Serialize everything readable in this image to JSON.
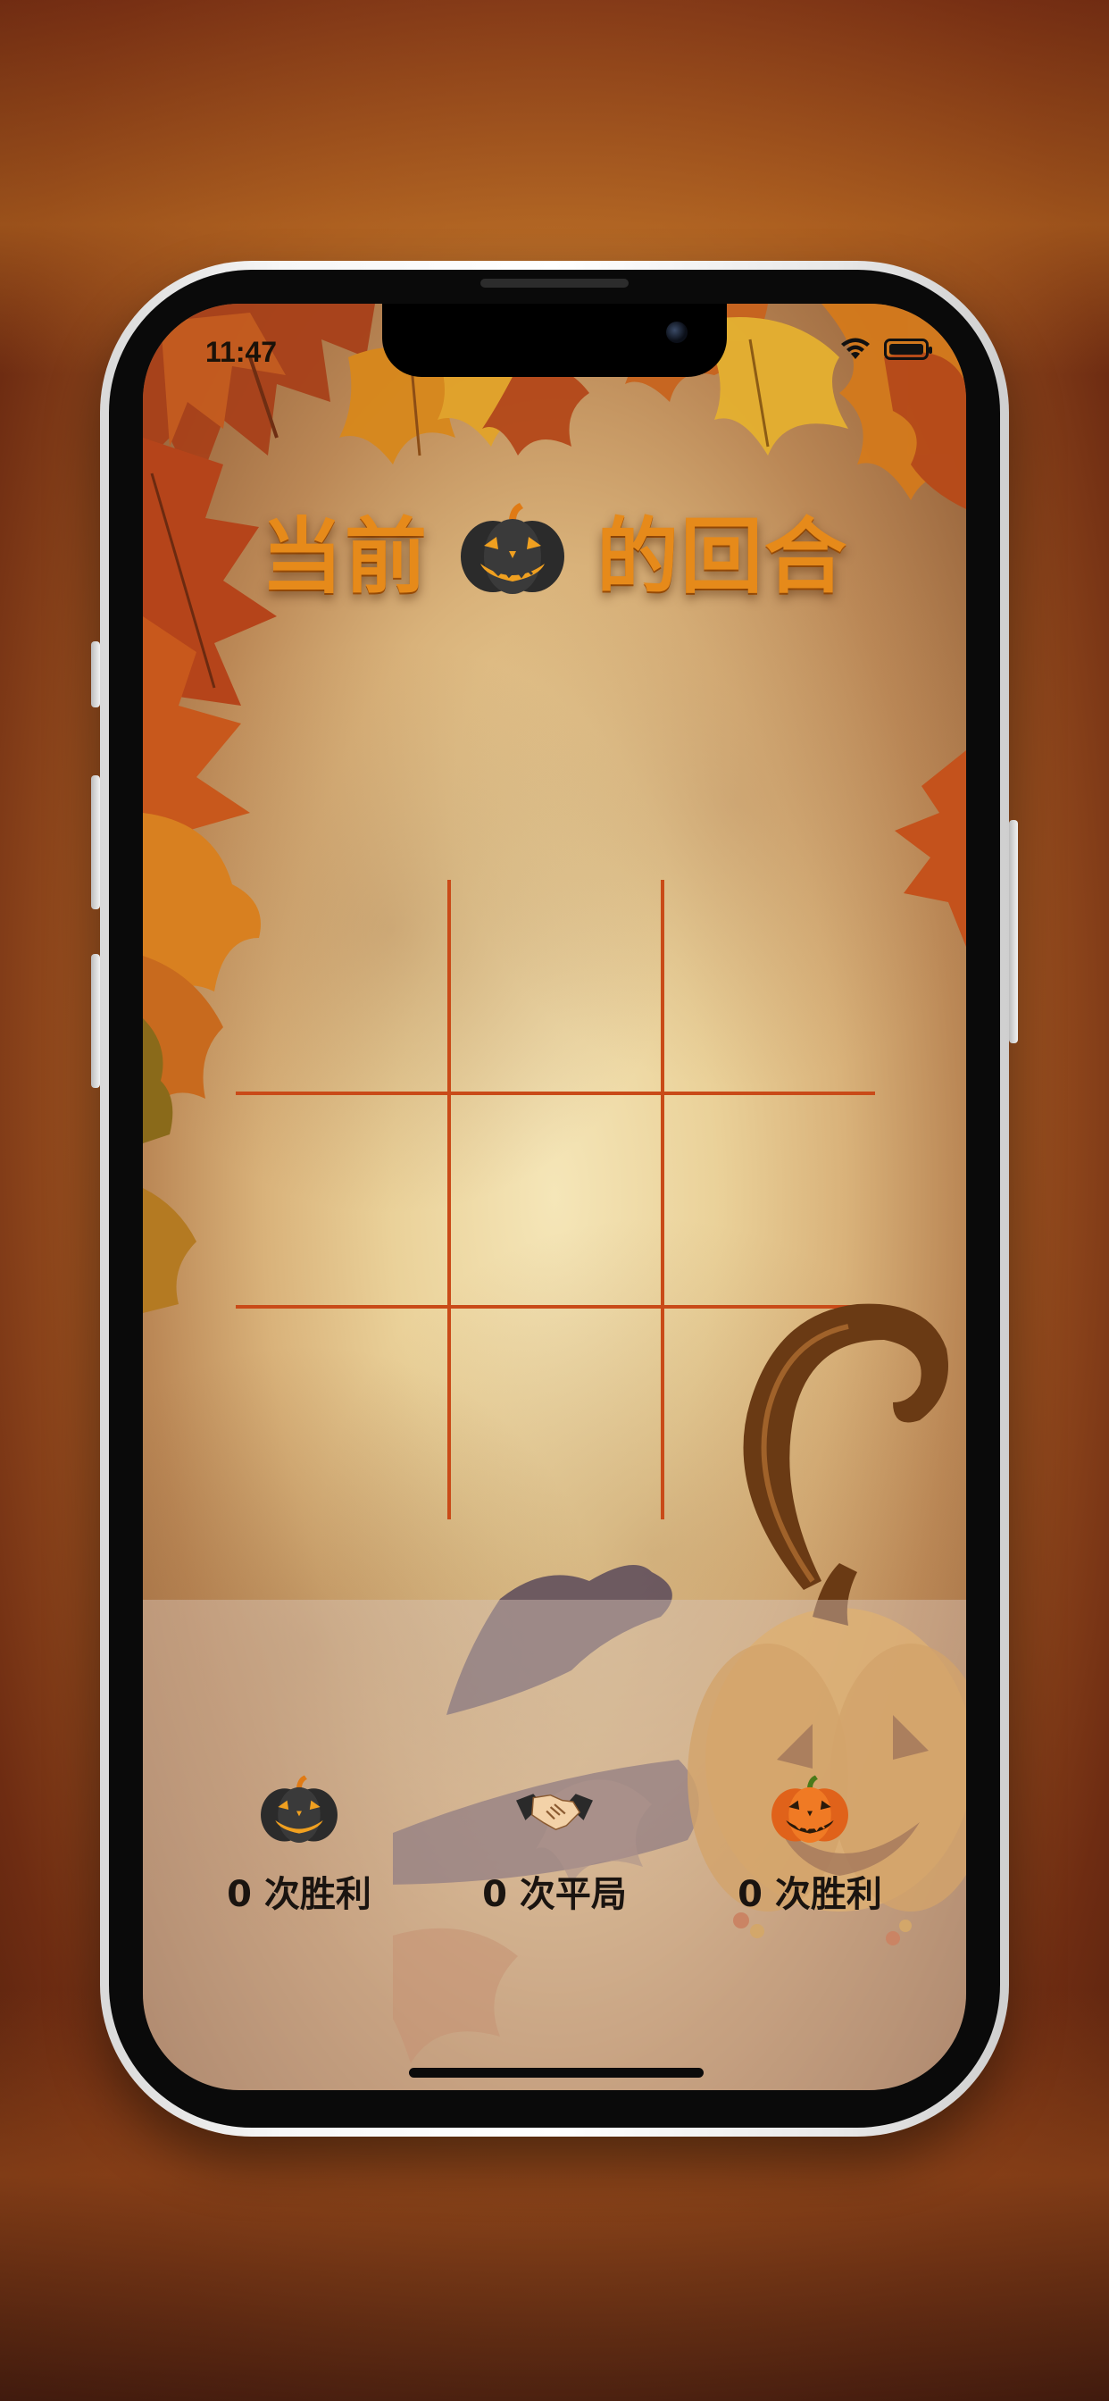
{
  "status_bar": {
    "time": "11:47"
  },
  "header": {
    "prefix": "当前",
    "suffix": "的回合",
    "current_player_icon": "black-jack-o-lantern-icon"
  },
  "board": {
    "cells": [
      "",
      "",
      "",
      "",
      "",
      "",
      "",
      "",
      ""
    ]
  },
  "scores": [
    {
      "icon": "black-jack-o-lantern-icon",
      "label": "0 次胜利"
    },
    {
      "icon": "handshake-icon",
      "label": "0 次平局"
    },
    {
      "icon": "orange-jack-o-lantern-icon",
      "label": "0 次胜利"
    }
  ],
  "colors": {
    "title": "#e68a1a",
    "grid": "#c94a18",
    "background": "#ead199"
  }
}
